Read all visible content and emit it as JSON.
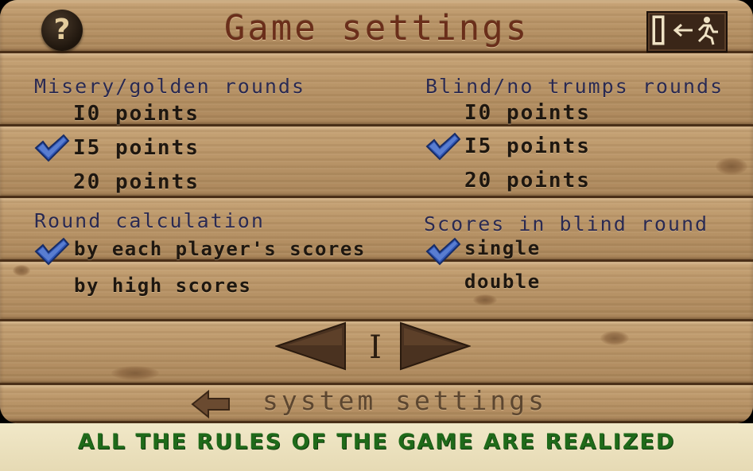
{
  "header": {
    "title": "Game settings",
    "help_label": "?",
    "help_icon": "question-mark-icon",
    "exit_icon": "exit-door-icon"
  },
  "left_column": {
    "misery_label": "Misery/golden rounds",
    "misery_options": [
      {
        "label": "I0 points",
        "selected": false
      },
      {
        "label": "I5 points",
        "selected": true
      },
      {
        "label": "20 points",
        "selected": false
      }
    ],
    "round_calc_label": "Round calculation",
    "round_calc_options": [
      {
        "label": "by each player's scores",
        "selected": true
      },
      {
        "label": "by high scores",
        "selected": false
      }
    ]
  },
  "right_column": {
    "blind_label": "Blind/no trumps rounds",
    "blind_options": [
      {
        "label": "I0 points",
        "selected": false
      },
      {
        "label": "I5 points",
        "selected": true
      },
      {
        "label": "20 points",
        "selected": false
      }
    ],
    "scores_blind_label": "Scores in blind round",
    "scores_blind_options": [
      {
        "label": "single",
        "selected": true
      },
      {
        "label": "double",
        "selected": false
      }
    ]
  },
  "pager": {
    "page": "I",
    "prev_icon": "triangle-left-icon",
    "next_icon": "triangle-right-icon"
  },
  "footer": {
    "system_label": "system settings",
    "back_icon": "arrow-left-icon"
  },
  "banner": {
    "text": "ALL THE RULES OF THE GAME ARE REALIZED"
  },
  "colors": {
    "title": "#6a2e1a",
    "section_label": "#2a2a52",
    "option_text": "#1e1710",
    "check": "#2f55b5",
    "banner_text": "#1f6a1a",
    "banner_bg": "#efe6c4"
  }
}
